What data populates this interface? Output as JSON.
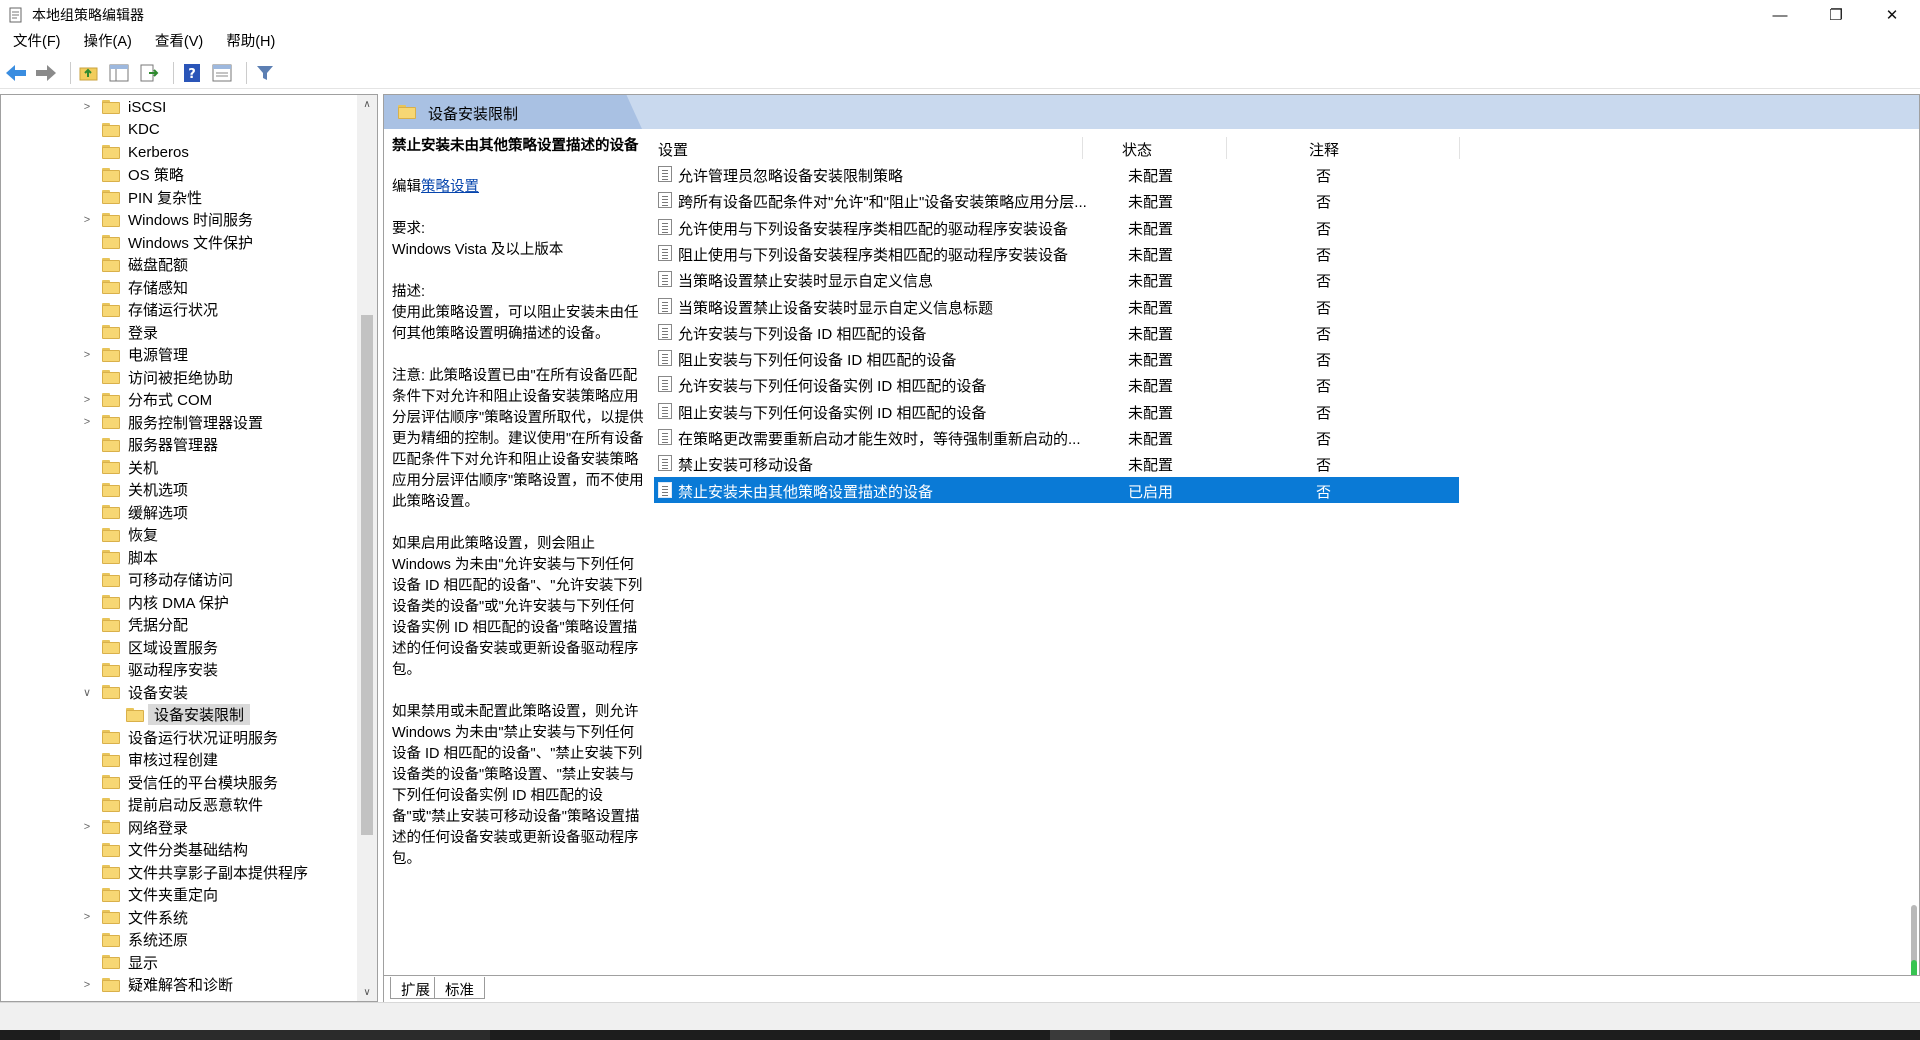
{
  "window": {
    "title": "本地组策略编辑器",
    "min_glyph": "—",
    "max_glyph": "❐",
    "close_glyph": "✕"
  },
  "menu": [
    "文件(F)",
    "操作(A)",
    "查看(V)",
    "帮助(H)"
  ],
  "toolbar_icons": [
    "back-arrow-icon",
    "forward-arrow-icon",
    "up-folder-icon",
    "show-hide-tree-icon",
    "export-list-icon",
    "help-icon",
    "properties-icon",
    "filter-icon"
  ],
  "tree": {
    "items": [
      {
        "label": "iSCSI",
        "expander": ">"
      },
      {
        "label": "KDC",
        "expander": ""
      },
      {
        "label": "Kerberos",
        "expander": ""
      },
      {
        "label": "OS 策略",
        "expander": ""
      },
      {
        "label": "PIN 复杂性",
        "expander": ""
      },
      {
        "label": "Windows 时间服务",
        "expander": ">"
      },
      {
        "label": "Windows 文件保护",
        "expander": ""
      },
      {
        "label": "磁盘配额",
        "expander": ""
      },
      {
        "label": "存储感知",
        "expander": ""
      },
      {
        "label": "存储运行状况",
        "expander": ""
      },
      {
        "label": "登录",
        "expander": ""
      },
      {
        "label": "电源管理",
        "expander": ">"
      },
      {
        "label": "访问被拒绝协助",
        "expander": ""
      },
      {
        "label": "分布式 COM",
        "expander": ">"
      },
      {
        "label": "服务控制管理器设置",
        "expander": ">"
      },
      {
        "label": "服务器管理器",
        "expander": ""
      },
      {
        "label": "关机",
        "expander": ""
      },
      {
        "label": "关机选项",
        "expander": ""
      },
      {
        "label": "缓解选项",
        "expander": ""
      },
      {
        "label": "恢复",
        "expander": ""
      },
      {
        "label": "脚本",
        "expander": ""
      },
      {
        "label": "可移动存储访问",
        "expander": ""
      },
      {
        "label": "内核 DMA 保护",
        "expander": ""
      },
      {
        "label": "凭据分配",
        "expander": ""
      },
      {
        "label": "区域设置服务",
        "expander": ""
      },
      {
        "label": "驱动程序安装",
        "expander": ""
      },
      {
        "label": "设备安装",
        "expander": "∨"
      },
      {
        "label": "设备安装限制",
        "expander": "",
        "child": true,
        "selected": true
      },
      {
        "label": "设备运行状况证明服务",
        "expander": ""
      },
      {
        "label": "审核过程创建",
        "expander": ""
      },
      {
        "label": "受信任的平台模块服务",
        "expander": ""
      },
      {
        "label": "提前启动反恶意软件",
        "expander": ""
      },
      {
        "label": "网络登录",
        "expander": ">"
      },
      {
        "label": "文件分类基础结构",
        "expander": ""
      },
      {
        "label": "文件共享影子副本提供程序",
        "expander": ""
      },
      {
        "label": "文件夹重定向",
        "expander": ""
      },
      {
        "label": "文件系统",
        "expander": ">"
      },
      {
        "label": "系统还原",
        "expander": ""
      },
      {
        "label": "显示",
        "expander": ""
      },
      {
        "label": "疑难解答和诊断",
        "expander": ">"
      }
    ],
    "scroll_up": "∧",
    "scroll_down": "∨"
  },
  "right": {
    "header_title": "设备安装限制",
    "desc": {
      "title": "禁止安装未由其他策略设置描述的设备",
      "edit_prefix": "编辑",
      "edit_link": "策略设置",
      "req_label": "要求:",
      "req_value": "Windows Vista 及以上版本",
      "desc_label": "描述:",
      "desc_text": "使用此策略设置，可以阻止安装未由任何其他策略设置明确描述的设备。",
      "note": "注意: 此策略设置已由\"在所有设备匹配条件下对允许和阻止设备安装策略应用分层评估顺序\"策略设置所取代，以提供更为精细的控制。建议使用\"在所有设备匹配条件下对允许和阻止设备安装策略应用分层评估顺序\"策略设置，而不使用此策略设置。",
      "if_enabled": "如果启用此策略设置，则会阻止 Windows 为未由\"允许安装与下列任何设备 ID 相匹配的设备\"、\"允许安装下列设备类的设备\"或\"允许安装与下列任何设备实例 ID 相匹配的设备\"策略设置描述的任何设备安装或更新设备驱动程序包。",
      "if_disabled": "如果禁用或未配置此策略设置，则允许 Windows 为未由\"禁止安装与下列任何设备 ID 相匹配的设备\"、\"禁止安装下列设备类的设备\"策略设置、\"禁止安装与下列任何设备实例 ID 相匹配的设备\"或\"禁止安装可移动设备\"策略设置描述的任何设备安装或更新设备驱动程序包。"
    },
    "columns": {
      "name": "设置",
      "state": "状态",
      "comment": "注释"
    },
    "rows": [
      {
        "name": "允许管理员忽略设备安装限制策略",
        "state": "未配置",
        "comment": "否"
      },
      {
        "name": "跨所有设备匹配条件对\"允许\"和\"阻止\"设备安装策略应用分层...",
        "state": "未配置",
        "comment": "否"
      },
      {
        "name": "允许使用与下列设备安装程序类相匹配的驱动程序安装设备",
        "state": "未配置",
        "comment": "否"
      },
      {
        "name": "阻止使用与下列设备安装程序类相匹配的驱动程序安装设备",
        "state": "未配置",
        "comment": "否"
      },
      {
        "name": "当策略设置禁止安装时显示自定义信息",
        "state": "未配置",
        "comment": "否"
      },
      {
        "name": "当策略设置禁止设备安装时显示自定义信息标题",
        "state": "未配置",
        "comment": "否"
      },
      {
        "name": "允许安装与下列设备 ID 相匹配的设备",
        "state": "未配置",
        "comment": "否"
      },
      {
        "name": "阻止安装与下列任何设备 ID 相匹配的设备",
        "state": "未配置",
        "comment": "否"
      },
      {
        "name": "允许安装与下列任何设备实例 ID 相匹配的设备",
        "state": "未配置",
        "comment": "否"
      },
      {
        "name": "阻止安装与下列任何设备实例 ID 相匹配的设备",
        "state": "未配置",
        "comment": "否"
      },
      {
        "name": "在策略更改需要重新启动才能生效时，等待强制重新启动的...",
        "state": "未配置",
        "comment": "否"
      },
      {
        "name": "禁止安装可移动设备",
        "state": "未配置",
        "comment": "否"
      },
      {
        "name": "禁止安装未由其他策略设置描述的设备",
        "state": "已启用",
        "comment": "否",
        "selected": true
      }
    ]
  },
  "bottom_tabs": [
    "扩展",
    "标准"
  ],
  "colors": {
    "selection": "#0a7ad6",
    "header_bg": "#c9d9ee",
    "folder": "#f7d774"
  }
}
